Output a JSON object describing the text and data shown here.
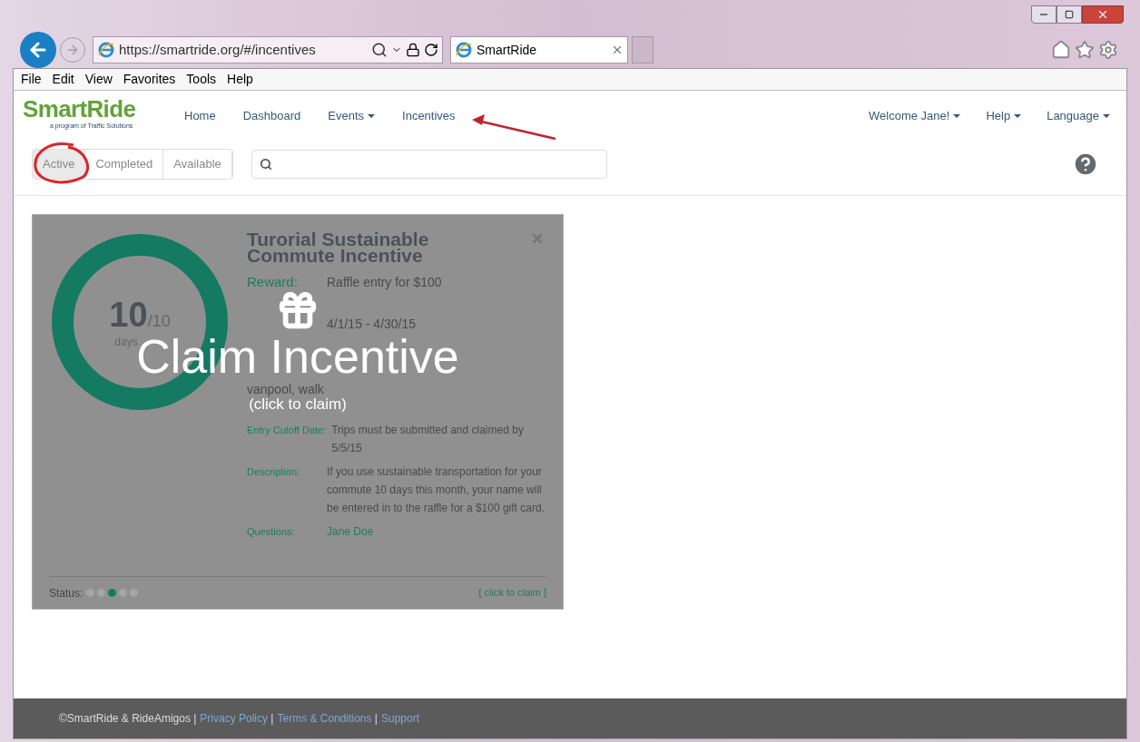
{
  "browser": {
    "url": "https://smartride.org/#/incentives",
    "tab_title": "SmartRide",
    "menu": [
      "File",
      "Edit",
      "View",
      "Favorites",
      "Tools",
      "Help"
    ]
  },
  "header": {
    "logo": "SmartRide",
    "logo_tagline": "a program of Traffic Solutions",
    "nav": [
      {
        "label": "Home",
        "dropdown": false
      },
      {
        "label": "Dashboard",
        "dropdown": false
      },
      {
        "label": "Events",
        "dropdown": true
      },
      {
        "label": "Incentives",
        "dropdown": false
      }
    ],
    "right_nav": [
      {
        "label": "Welcome Jane!",
        "dropdown": true
      },
      {
        "label": "Help",
        "dropdown": true
      },
      {
        "label": "Language",
        "dropdown": true
      }
    ]
  },
  "tabs": [
    {
      "label": "Active",
      "selected": true
    },
    {
      "label": "Completed",
      "selected": false
    },
    {
      "label": "Available",
      "selected": false
    }
  ],
  "card": {
    "title": "Turorial Sustainable Commute Incentive",
    "progress": {
      "value": "10",
      "total": "/10",
      "unit": "days",
      "level": 1
    },
    "reward": {
      "label": "Reward:",
      "value": "Raffle entry for $100"
    },
    "dates_value": "4/1/15 - 4/30/15",
    "modes_tail": "vanpool, walk",
    "fields": [
      {
        "label": "Entry Cutoff Date:",
        "value": "Trips must be submitted and claimed by 5/5/15",
        "link": false
      },
      {
        "label": "Description:",
        "value": "If you use sustainable transportation for your commute 10 days this month, your name will be entered in to the raffle for a $100 gift card.",
        "link": false
      },
      {
        "label": "Questions:",
        "value": "Jane Doe",
        "link": true
      }
    ],
    "status_label": "Status:",
    "status_dots": [
      {
        "selected": false
      },
      {
        "selected": false
      },
      {
        "selected": true
      },
      {
        "selected": false
      },
      {
        "selected": false
      }
    ],
    "claim_link": "[ click to claim ]",
    "overlay": {
      "title": "Claim Incentive",
      "subtitle": "(click to claim)"
    }
  },
  "footer": {
    "copyright": "©SmartRide & RideAmigos |",
    "links": [
      {
        "label": "Privacy Policy",
        "sep": " |"
      },
      {
        "label": "Terms & Conditions",
        "sep": " |"
      },
      {
        "label": "Support"
      }
    ]
  }
}
